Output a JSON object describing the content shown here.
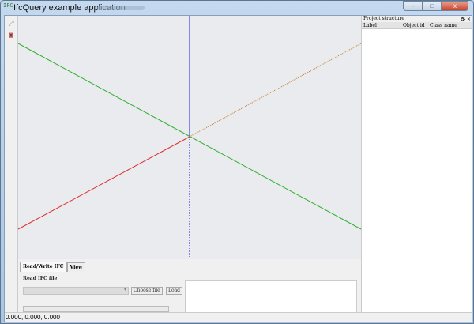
{
  "window": {
    "title": "IfcQuery example application",
    "icon_text": "IFC",
    "buttons": {
      "minimize": "–",
      "maximize": "□",
      "close": "x"
    }
  },
  "toolbar": {
    "icons": [
      "fit-view-icon",
      "person-icon"
    ]
  },
  "viewport": {
    "axes_colors": {
      "x_pos": "#c8782a",
      "x_neg": "#e03030",
      "y_pos": "#30b030",
      "y_neg": "#30b030",
      "z": "#2020e0"
    }
  },
  "tabs": [
    {
      "label": "Read/Write IFC",
      "active": true
    },
    {
      "label": "View",
      "active": false
    }
  ],
  "read_panel": {
    "label": "Read IFC file",
    "combo_value": "",
    "choose_file": "Choose file",
    "load": "Load",
    "progress": 0
  },
  "project_structure": {
    "title": "Project structure",
    "float_icon": "🗗",
    "close_icon": "×",
    "columns": [
      "Label",
      "Object id",
      "Class name"
    ]
  },
  "status": {
    "coordinates": "0.000, 0.000, 0.000"
  }
}
